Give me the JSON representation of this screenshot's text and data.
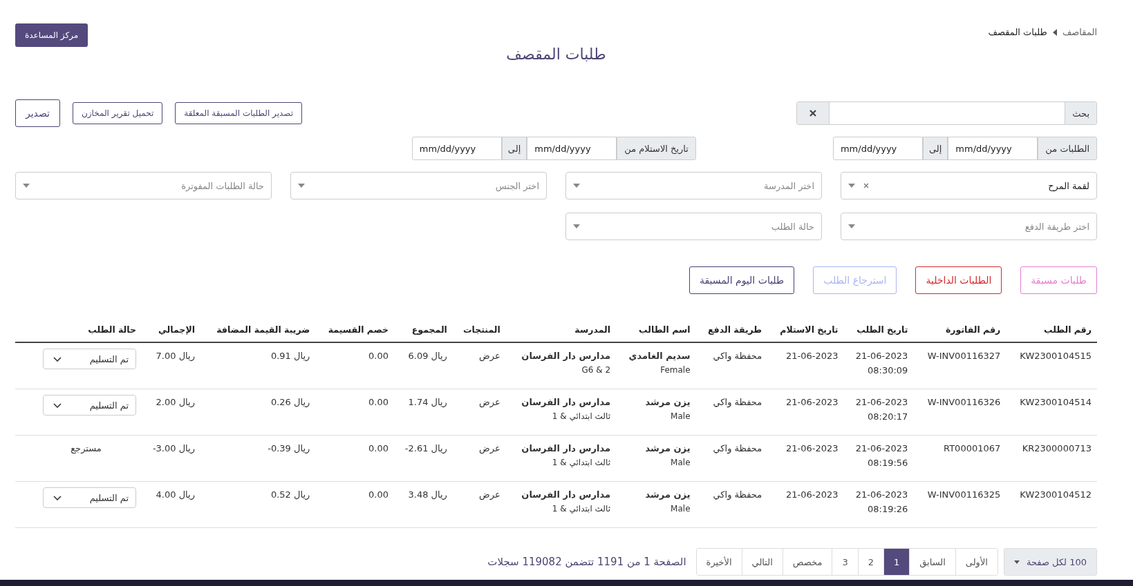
{
  "breadcrumb": {
    "parent": "المقاصف",
    "current": "طلبات المقصف"
  },
  "help_button": "مركز المساعدة",
  "title": "طلبات المقصف",
  "search": {
    "label": "بحث"
  },
  "export_buttons": [
    {
      "label": "تصدير الطلبات المسبقة المعلقة",
      "kind": "small"
    },
    {
      "label": "تحميل تقرير المخازن",
      "kind": "small"
    },
    {
      "label": "تصدير",
      "kind": "large"
    }
  ],
  "date_ranges": [
    {
      "label": "الطلبات من",
      "from_placeholder": "mm/dd/yyyy",
      "to_label": "إلى",
      "to_placeholder": "mm/dd/yyyy"
    },
    {
      "label": "تاريخ الاستلام من",
      "from_placeholder": "mm/dd/yyyy",
      "to_label": "إلى",
      "to_placeholder": "mm/dd/yyyy"
    }
  ],
  "filters": [
    {
      "value": "لقمة المرح",
      "clearable": true
    },
    {
      "placeholder": "اختر المدرسة",
      "clearable": false
    },
    {
      "placeholder": "اختر الجنس",
      "clearable": false
    },
    {
      "placeholder": "حالة الطلبات المفوترة",
      "clearable": false
    },
    {
      "placeholder": "اختر طريقة الدفع",
      "clearable": false
    },
    {
      "placeholder": "حالة الطلب",
      "clearable": false
    }
  ],
  "order_type_buttons": [
    {
      "label": "طلبات مسبقة",
      "color": "#e27fd0"
    },
    {
      "label": "الطلبات الداخلية",
      "color": "#d42a2f"
    },
    {
      "label": "استرجاع الطلب",
      "color": "#a9b6f2"
    },
    {
      "label": "طلبات اليوم المسبقة",
      "color": "#4b4076"
    }
  ],
  "table": {
    "columns": [
      "رقم الطلب",
      "رقم الفاتورة",
      "تاريخ الطلب",
      "تاريخ الاستلام",
      "طريقة الدفع",
      "اسم الطالب",
      "المدرسة",
      "المنتجات",
      "المجموع",
      "خصم القسيمة",
      "ضريبة القيمة المضافة",
      "الإجمالي",
      "حالة الطلب"
    ],
    "rows": [
      {
        "order_no": "KW2300104515",
        "invoice_no": "W-INV00116327",
        "order_date": "21-06-2023",
        "order_time": "08:30:09",
        "receipt_date": "21-06-2023",
        "payment": "محفظة واكي",
        "student": "سديم الغامدي",
        "gender": "Female",
        "school": "مدارس دار الفرسان",
        "grade": "2 & G6",
        "products": "عرض",
        "subtotal": "6.09 ريال",
        "discount": "0.00",
        "vat": "0.91 ريال",
        "total": "7.00 ريال",
        "status": {
          "kind": "select",
          "label": "تم التسليم"
        }
      },
      {
        "order_no": "KW2300104514",
        "invoice_no": "W-INV00116326",
        "order_date": "21-06-2023",
        "order_time": "08:20:17",
        "receipt_date": "21-06-2023",
        "payment": "محفظة واكي",
        "student": "يزن مرشد",
        "gender": "Male",
        "school": "مدارس دار الفرسان",
        "grade": "ثالث ابتدائي & 1",
        "products": "عرض",
        "subtotal": "1.74 ريال",
        "discount": "0.00",
        "vat": "0.26 ريال",
        "total": "2.00 ريال",
        "status": {
          "kind": "select",
          "label": "تم التسليم"
        }
      },
      {
        "order_no": "KR2300000713",
        "invoice_no": "RT00001067",
        "order_date": "21-06-2023",
        "order_time": "08:19:56",
        "receipt_date": "21-06-2023",
        "payment": "محفظة واكي",
        "student": "يزن مرشد",
        "gender": "Male",
        "school": "مدارس دار الفرسان",
        "grade": "ثالث ابتدائي & 1",
        "products": "عرض",
        "subtotal": "-2.61 ريال",
        "discount": "0.00",
        "vat": "-0.39 ريال",
        "total": "-3.00 ريال",
        "status": {
          "kind": "text",
          "label": "مسترجع"
        }
      },
      {
        "order_no": "KW2300104512",
        "invoice_no": "W-INV00116325",
        "order_date": "21-06-2023",
        "order_time": "08:19:26",
        "receipt_date": "21-06-2023",
        "payment": "محفظة واكي",
        "student": "يزن مرشد",
        "gender": "Male",
        "school": "مدارس دار الفرسان",
        "grade": "ثالث ابتدائي & 1",
        "products": "عرض",
        "subtotal": "3.48 ريال",
        "discount": "0.00",
        "vat": "0.52 ريال",
        "total": "4.00 ريال",
        "status": {
          "kind": "select",
          "label": "تم التسليم"
        }
      }
    ]
  },
  "pagination": {
    "per_page": "100 لكل صفحة",
    "pages": [
      {
        "label": "الأولى",
        "selected": false
      },
      {
        "label": "السابق",
        "selected": false
      },
      {
        "label": "1",
        "selected": true
      },
      {
        "label": "2",
        "selected": false
      },
      {
        "label": "3",
        "selected": false
      },
      {
        "label": "مخصص",
        "selected": false
      },
      {
        "label": "التالي",
        "selected": false
      },
      {
        "label": "الأخيرة",
        "selected": false
      }
    ],
    "summary": "الصفحة 1 من 1191 تتضمن 119082 سجلات"
  }
}
